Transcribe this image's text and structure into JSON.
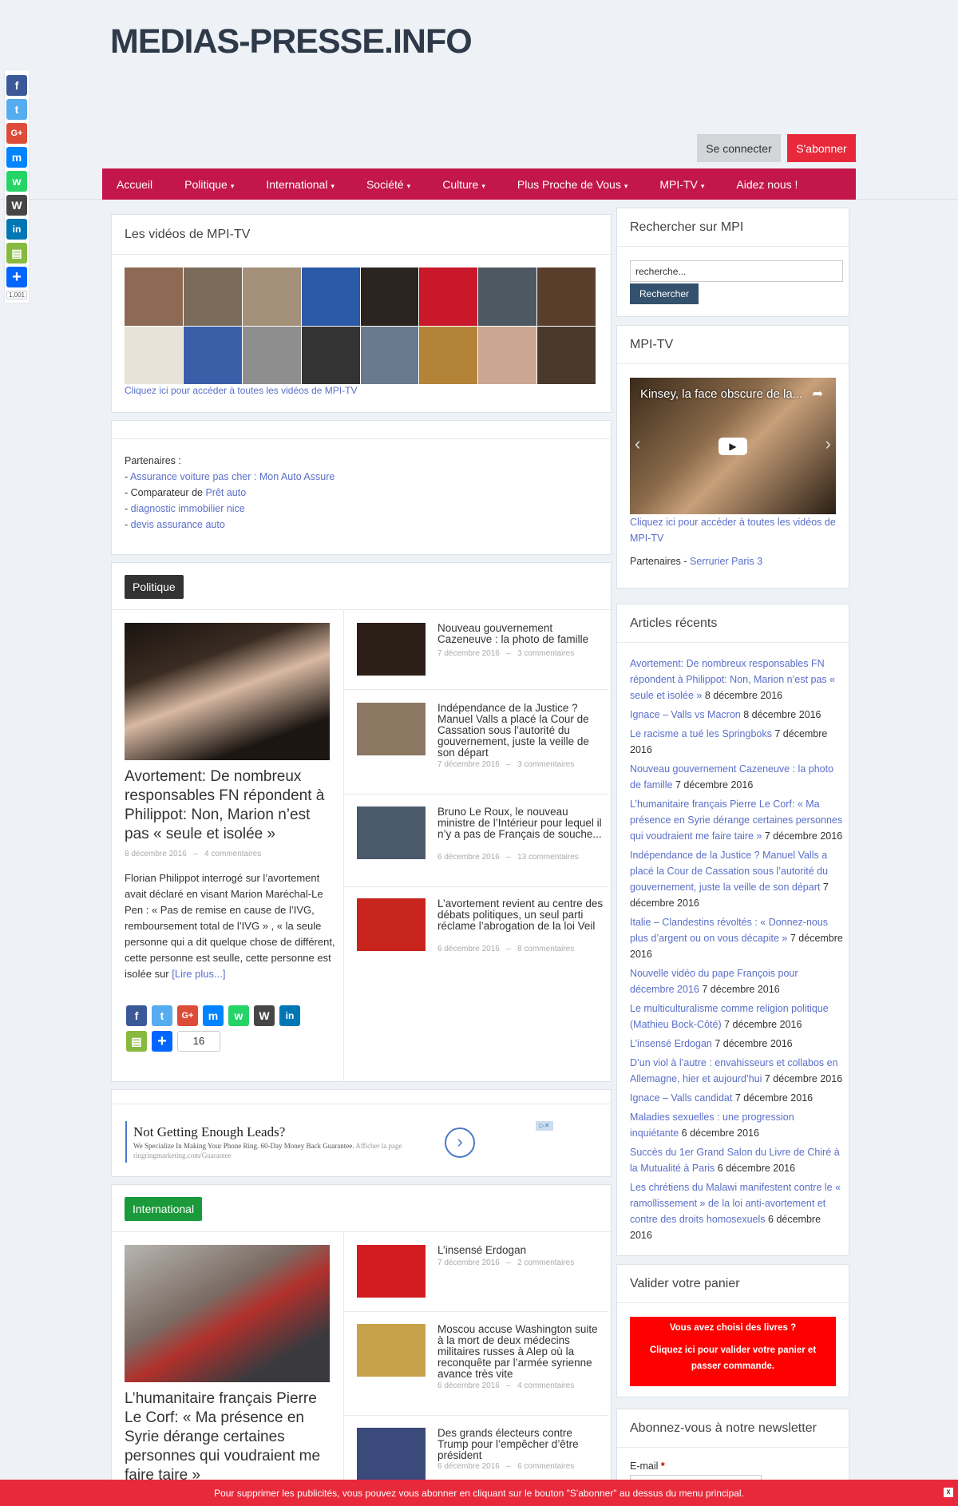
{
  "site": {
    "logo": "MEDIAS-PRESSE.INFO",
    "login": "Se connecter",
    "subscribe": "S'abonner"
  },
  "nav": [
    {
      "label": "Accueil",
      "caret": ""
    },
    {
      "label": "Politique",
      "caret": "▾"
    },
    {
      "label": "International",
      "caret": "▾"
    },
    {
      "label": "Société",
      "caret": "▾"
    },
    {
      "label": "Culture",
      "caret": "▾"
    },
    {
      "label": "Plus Proche de Vous",
      "caret": "▾"
    },
    {
      "label": "MPI-TV",
      "caret": "▾"
    },
    {
      "label": "Aidez nous !",
      "caret": ""
    }
  ],
  "share_side": {
    "count": "1,001"
  },
  "videos": {
    "title": "Les vidéos de MPI-TV",
    "link": "Cliquez ici pour accéder à toutes les vidéos de MPI-TV"
  },
  "partners": {
    "label": "Partenaires :",
    "items": [
      {
        "prefix": "- ",
        "text": "",
        "link": "Assurance voiture pas cher : Mon Auto Assure"
      },
      {
        "prefix": "- ",
        "text": "Comparateur de ",
        "link": "Prêt auto"
      },
      {
        "prefix": "- ",
        "text": "",
        "link": "diagnostic immobilier nice"
      },
      {
        "prefix": "- ",
        "text": "",
        "link": "devis assurance auto"
      }
    ]
  },
  "politique": {
    "badge": "Politique",
    "badge_color": "#333333",
    "featured": {
      "title": "Avortement: De nombreux responsables FN répondent à Philippot: Non, Marion n’est pas « seule et isolée »",
      "date": "8 décembre 2016",
      "comments": "4 commentaires",
      "excerpt": "Florian Philippot interrogé sur l’avortement avait déclaré en visant Marion Maréchal-Le Pen : « Pas de remise en cause de l’IVG, remboursement total de l’IVG » ,  « la seule personne qui a dit quelque chose de différent, cette personne est seulle, cette personne est isolée sur ",
      "more": "[Lire plus...]",
      "share_count": "16"
    },
    "list": [
      {
        "title": "Nouveau gouvernement Cazeneuve : la photo de famille",
        "date": "7 décembre 2016",
        "comments": "3 commentaires"
      },
      {
        "title": "Indépendance de la Justice ? Manuel Valls a placé la Cour de Cassation sous l’autorité du gouvernement, juste la veille de son départ",
        "date": "7 décembre 2016",
        "comments": "3 commentaires"
      },
      {
        "title": "Bruno Le Roux, le nouveau ministre de l’Intérieur pour lequel il n’y a pas de Français de souche...",
        "date": "6 décembre 2016",
        "comments": "13 commentaires"
      },
      {
        "title": "L’avortement revient au centre des débats politiques, un seul parti réclame l’abrogation de la loi Veil",
        "date": "6 décembre 2016",
        "comments": "8 commentaires"
      }
    ]
  },
  "ad": {
    "title": "Not Getting Enough Leads?",
    "text": "We Specialize In Making Your Phone Ring. 60-Day Money Back Guarantee.",
    "afficher": "Afficher la page",
    "url": "ringringmarketing.com/Guarantee"
  },
  "international": {
    "badge": "International",
    "badge_color": "#1a9a3a",
    "featured": {
      "title": "L’humanitaire français Pierre Le Corf: « Ma présence en Syrie dérange certaines personnes qui voudraient me faire taire »"
    },
    "list": [
      {
        "title": "L’insensé Erdogan",
        "date": "7 décembre 2016",
        "comments": "2 commentaires"
      },
      {
        "title": "Moscou accuse Washington suite à la mort de deux médecins militaires russes à Alep où la reconquête par l’armée syrienne avance très vite",
        "date": "6 décembre 2016",
        "comments": "4 commentaires"
      },
      {
        "title": "Des grands électeurs contre Trump pour l’empêcher d’être président",
        "date": "6 décembre 2016",
        "comments": "6 commentaires"
      }
    ]
  },
  "sidebar": {
    "search": {
      "title": "Rechercher sur MPI",
      "placeholder": "recherche...",
      "button": "Rechercher"
    },
    "mpitv": {
      "title": "MPI-TV",
      "video_title": "Kinsey, la face obscure de la...",
      "link": "Cliquez ici pour accéder à toutes les vidéos de MPI-TV",
      "partners_label": "Partenaires - ",
      "partners_link": "Serrurier Paris 3"
    },
    "recent": {
      "title": "Articles récents",
      "items": [
        {
          "link": "Avortement: De nombreux responsables FN répondent à Philippot: Non, Marion n’est pas « seule et isolée »",
          "date": "8 décembre 2016"
        },
        {
          "link": "Ignace – Valls vs Macron",
          "date": "8 décembre 2016"
        },
        {
          "link": "Le racisme a tué les Springboks",
          "date": "7 décembre 2016"
        },
        {
          "link": "Nouveau gouvernement Cazeneuve : la photo de famille",
          "date": "7 décembre 2016"
        },
        {
          "link": "L’humanitaire français Pierre Le Corf: « Ma présence en Syrie dérange certaines personnes qui voudraient me faire taire »",
          "date": "7 décembre 2016"
        },
        {
          "link": "Indépendance de la Justice ? Manuel Valls a placé la Cour de Cassation sous l’autorité du gouvernement, juste la veille de son départ",
          "date": "7 décembre 2016"
        },
        {
          "link": "Italie – Clandestins révoltés : « Donnez-nous plus d’argent ou on vous décapite »",
          "date": "7 décembre 2016"
        },
        {
          "link": "Nouvelle vidéo du pape François pour décembre 2016",
          "date": "7 décembre 2016"
        },
        {
          "link": "Le multiculturalisme comme religion politique (Mathieu Bock-Côté)",
          "date": "7 décembre 2016"
        },
        {
          "link": "L’insensé Erdogan",
          "date": "7 décembre 2016"
        },
        {
          "link": "D’un viol à l’autre : envahisseurs et collabos en Allemagne, hier et aujourd’hui",
          "date": "7 décembre 2016"
        },
        {
          "link": "Ignace – Valls candidat",
          "date": "7 décembre 2016"
        },
        {
          "link": "Maladies sexuelles : une progression inquiétante",
          "date": "6 décembre 2016"
        },
        {
          "link": "Succès du 1er Grand Salon du Livre de Chiré à la Mutualité à Paris",
          "date": "6 décembre 2016"
        },
        {
          "link": "Les chrétiens du Malawi manifestent contre le « ramollissement » de la loi anti-avortement et contre des droits homosexuels",
          "date": "6 décembre 2016"
        }
      ]
    },
    "cart": {
      "title": "Valider votre panier",
      "line1": "Vous avez choisi des livres ?",
      "line2": "Cliquez ici pour valider votre panier et passer commande."
    },
    "newsletter": {
      "title": "Abonnez-vous à notre newsletter",
      "email_label": "E-mail",
      "required": "*"
    }
  },
  "bottom_bar": {
    "text": "Pour supprimer les publicités, vous pouvez vous abonner en cliquant sur le bouton \"S'abonner\" au dessus du menu principal.",
    "close": "x"
  },
  "colors": {
    "nav": "#c3164a",
    "subscribe": "#e8293b",
    "link": "#5a6fc9"
  }
}
